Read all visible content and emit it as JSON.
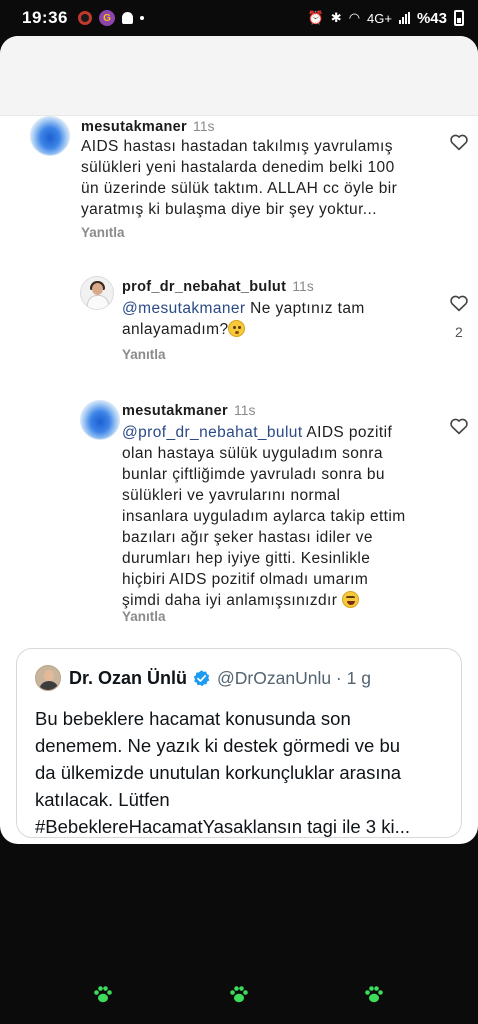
{
  "status_bar": {
    "time": "19:36",
    "battery": "%43",
    "network": "4G+"
  },
  "comments": [
    {
      "username": "mesutakmaner",
      "time_ago": "11s",
      "lines": [
        "AIDS hastası hastadan takılmış yavrulamış",
        "sülükleri yeni hastalarda denedim belki 100",
        "ün üzerinde sülük taktım. ALLAH cc öyle bir",
        "yaratmış ki bulaşma diye bir şey yoktur..."
      ],
      "reply_label": "Yanıtla"
    },
    {
      "username": "prof_dr_nebahat_bulut",
      "time_ago": "11s",
      "mention": "@mesutakmaner",
      "line1_rest": " Ne yaptınız tam",
      "line2": "anlayamadım?",
      "reply_label": "Yanıtla",
      "like_count": "2"
    },
    {
      "username": "mesutakmaner",
      "time_ago": "11s",
      "mention": "@prof_dr_nebahat_bulut",
      "line1_rest": " AIDS pozitif",
      "lines": [
        "olan hastaya sülük uyguladım sonra",
        "bunlar çiftliğimde yavruladı sonra bu",
        "sülükleri ve yavrularını normal",
        "insanlara uyguladım aylarca takip ettim",
        "bazıları ağır şeker hastası idiler ve",
        "durumları hep iyiye gitti. Kesinlikle",
        "hiçbiri AIDS pozitif olmadı umarım"
      ],
      "last_line": "şimdi daha iyi anlamışsınızdır",
      "reply_label": "Yanıtla"
    }
  ],
  "tweet": {
    "name": "Dr. Ozan Ünlü",
    "handle": "@DrOzanUnlu · 1 g",
    "lines": [
      "Bu bebeklere hacamat konusunda son",
      "denemem. Ne yazık ki destek görmedi ve bu",
      "da ülkemizde unutulan korkunçluklar arasına",
      "katılacak. Lütfen",
      "#BebeklereHacamatYasaklansın tagi ile 3 ki..."
    ]
  },
  "colors": {
    "accent_blue": "#1d9bf0",
    "paw_green": "#3ddc5a",
    "mention": "#2b4a86"
  },
  "icons": [
    "heart-icon",
    "verified-badge-icon",
    "paw-icon"
  ]
}
